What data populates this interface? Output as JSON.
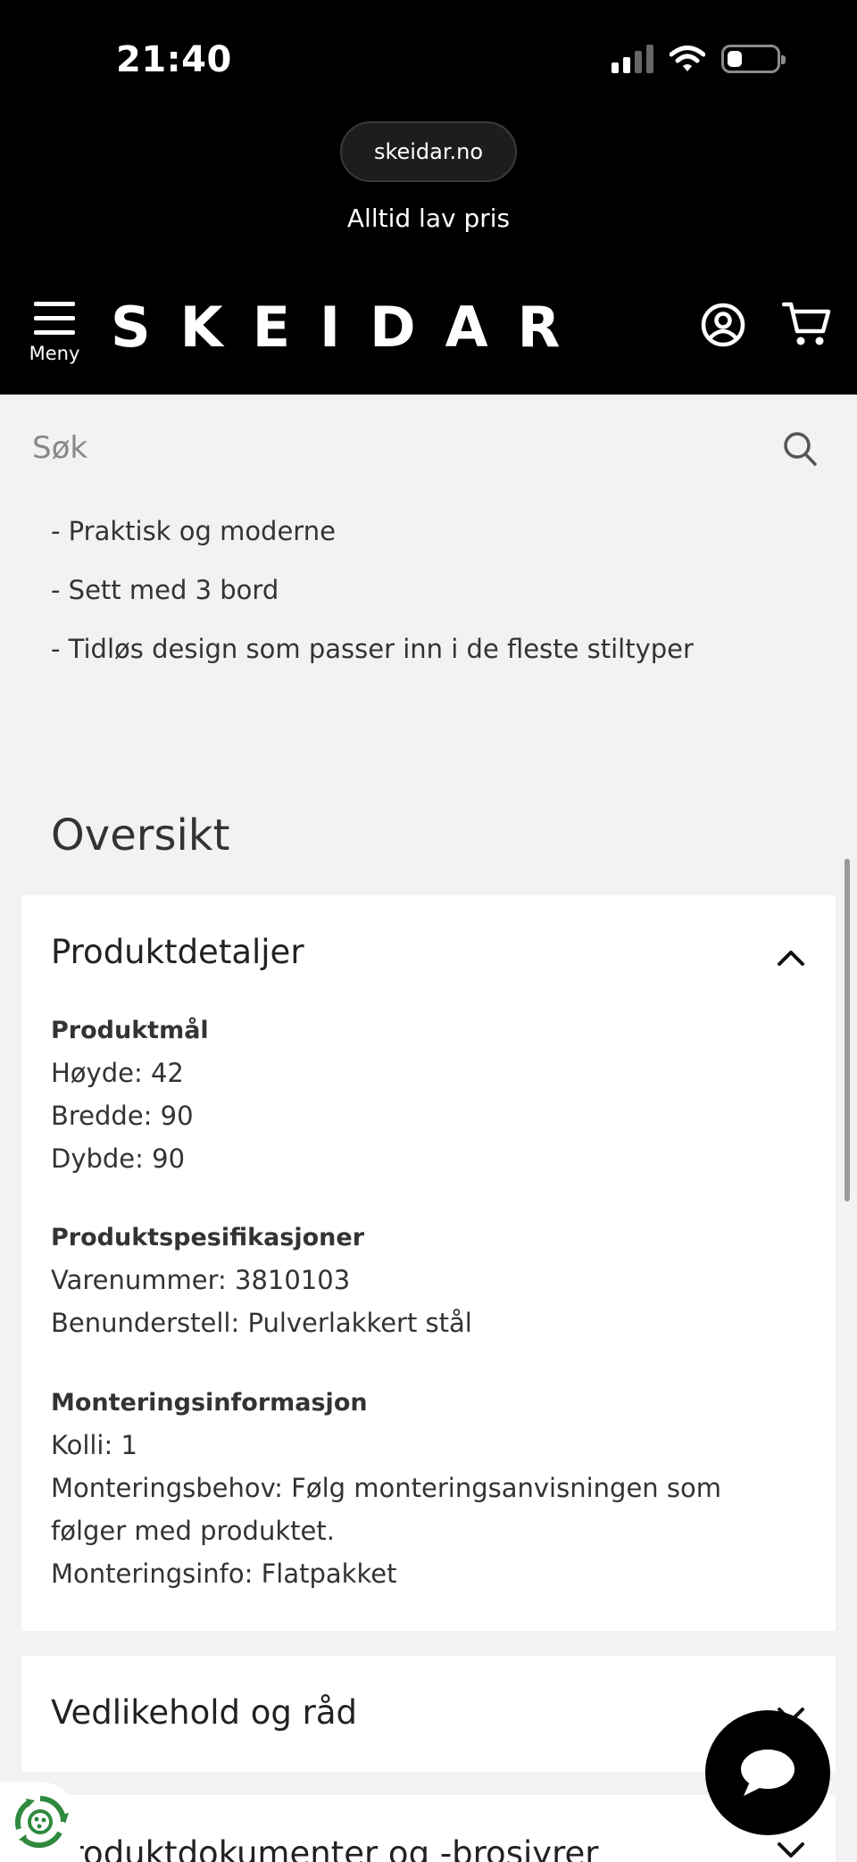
{
  "status_bar": {
    "time": "21:40"
  },
  "browser": {
    "url": "skeidar.no"
  },
  "header": {
    "tagline": "Alltid lav pris",
    "menu_label": "Meny",
    "logo": "SKEIDAR"
  },
  "search": {
    "placeholder": "Søk"
  },
  "features": [
    "- Praktisk og moderne",
    "- Sett med 3 bord",
    "- Tidløs design som passer inn i de fleste stiltyper"
  ],
  "overview": {
    "title": "Oversikt",
    "product_details": {
      "title": "Produktdetaljer",
      "sections": [
        {
          "heading": "Produktmål",
          "lines": [
            "Høyde: 42",
            "Bredde: 90",
            "Dybde: 90"
          ]
        },
        {
          "heading": "Produktspesifikasjoner",
          "lines": [
            "Varenummer: 3810103",
            "Benunderstell: Pulverlakkert stål"
          ]
        },
        {
          "heading": "Monteringsinformasjon",
          "lines": [
            "Kolli: 1",
            "Monteringsbehov: Følg monteringsanvisningen som",
            "følger med produktet.",
            "Monteringsinfo: Flatpakket"
          ]
        }
      ]
    },
    "care": {
      "title": "Vedlikehold og råd"
    },
    "documents": {
      "title": "Produktdokumenter og -brosjyrer"
    }
  },
  "icons": [
    "hamburger-icon",
    "user-icon",
    "cart-icon",
    "search-icon",
    "chevron-up-icon",
    "chevron-down-icon",
    "chat-icon",
    "recycle-icon"
  ]
}
